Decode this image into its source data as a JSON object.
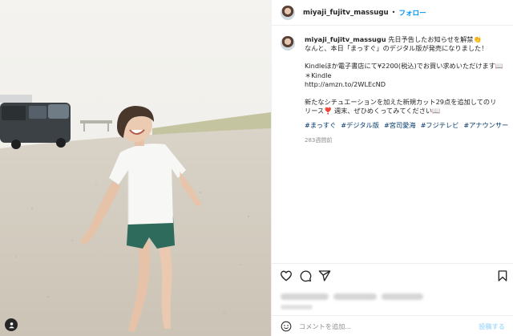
{
  "post": {
    "username": "miyaji_fujitv_massugu",
    "follow_label": "フォロー",
    "caption_lines": [
      "先日予告したお知らせを解禁👏",
      "なんと、本日「まっすぐ」のデジタル版が発売になりました！",
      "",
      "Kindleほか電子書店にて¥2200(税込)でお買い求めいただけます📖",
      "＊Kindle",
      "http://amzn.to/2WLEcND",
      "",
      "新たなシチュエーションを加えた新規カット29点を追加してのリ",
      "リース❣️ 週末、ぜひめくってみてください📖"
    ],
    "hashtags": [
      "#まっすぐ",
      "#デジタル版",
      "#宮司愛海",
      "#フジテレビ",
      "#アナウンサー"
    ],
    "time_ago": "283週間前"
  },
  "comment": {
    "placeholder": "コメントを追加...",
    "post_label": "投稿する"
  },
  "icons": {
    "like": "heart-icon",
    "comment": "comment-icon",
    "share": "send-icon",
    "save": "bookmark-icon",
    "emoji": "emoji-icon",
    "tag": "user-tag-icon"
  },
  "colors": {
    "link_blue": "#0095f6",
    "hashtag": "#00376b",
    "muted": "#8e8e8e"
  }
}
